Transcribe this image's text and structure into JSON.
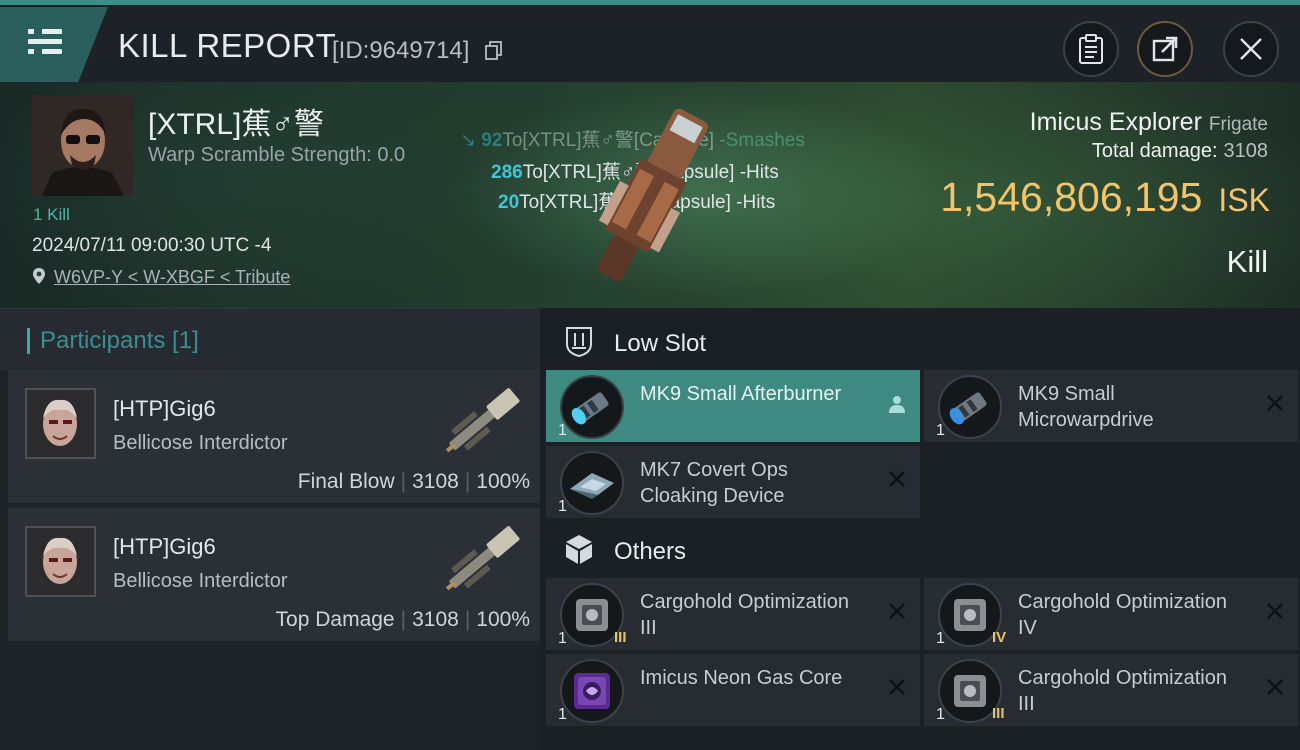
{
  "header": {
    "title": "KILL REPORT",
    "report_id": "[ID:9649714]"
  },
  "victim": {
    "name": "[XTRL]蕉♂警",
    "warp_scramble": "Warp Scramble Strength: 0.0",
    "kills": "1 Kill",
    "datetime": "2024/07/11 09:00:30 UTC -4",
    "location": "W6VP-Y < W-XBGF < Tribute"
  },
  "hits": [
    {
      "amount": "92",
      "text": "To[XTRL]蕉♂警[Capsule]",
      "verb": "-Smashes"
    },
    {
      "amount": "286",
      "text": "To[XTRL]蕉♂警[Capsule]",
      "verb": "-Hits"
    },
    {
      "amount": "20",
      "text": "To[XTRL]蕉♂警[Capsule]",
      "verb": "-Hits"
    }
  ],
  "ship": {
    "name": "Imicus Explorer",
    "class": "Frigate",
    "total_damage_label": "Total damage:",
    "total_damage": "3108",
    "isk_value": "1,546,806,195",
    "isk_unit": "ISK",
    "result": "Kill"
  },
  "participants_header": "Participants [1]",
  "participants": [
    {
      "name": "[HTP]Gig6",
      "ship": "Bellicose Interdictor",
      "role": "Final Blow",
      "damage": "3108",
      "percent": "100%"
    },
    {
      "name": "[HTP]Gig6",
      "ship": "Bellicose Interdictor",
      "role": "Top Damage",
      "damage": "3108",
      "percent": "100%"
    }
  ],
  "fitting": {
    "low_slot_label": "Low Slot",
    "others_label": "Others",
    "low_slot": [
      {
        "name": "MK9 Small Afterburner",
        "qty": "1",
        "meta": "",
        "active": true,
        "icon": "afterburner-icon"
      },
      {
        "name": "MK9 Small Microwarpdrive",
        "qty": "1",
        "meta": "",
        "active": false,
        "icon": "microwarpdrive-icon"
      },
      {
        "name": "MK7 Covert Ops Cloaking Device",
        "qty": "1",
        "meta": "",
        "active": false,
        "icon": "cloak-icon"
      }
    ],
    "others": [
      {
        "name": "Cargohold Optimization III",
        "qty": "1",
        "meta": "III",
        "icon": "cargohold-icon"
      },
      {
        "name": "Cargohold Optimization IV",
        "qty": "1",
        "meta": "IV",
        "icon": "cargohold-icon"
      },
      {
        "name": "Imicus Neon Gas Core",
        "qty": "1",
        "meta": "",
        "icon": "gas-core-icon"
      },
      {
        "name": "Cargohold Optimization III",
        "qty": "1",
        "meta": "III",
        "icon": "cargohold-icon"
      }
    ]
  },
  "colors": {
    "accent": "#3e8a82",
    "isk": "#f3c46a",
    "hit_number": "#3fc6d6"
  }
}
